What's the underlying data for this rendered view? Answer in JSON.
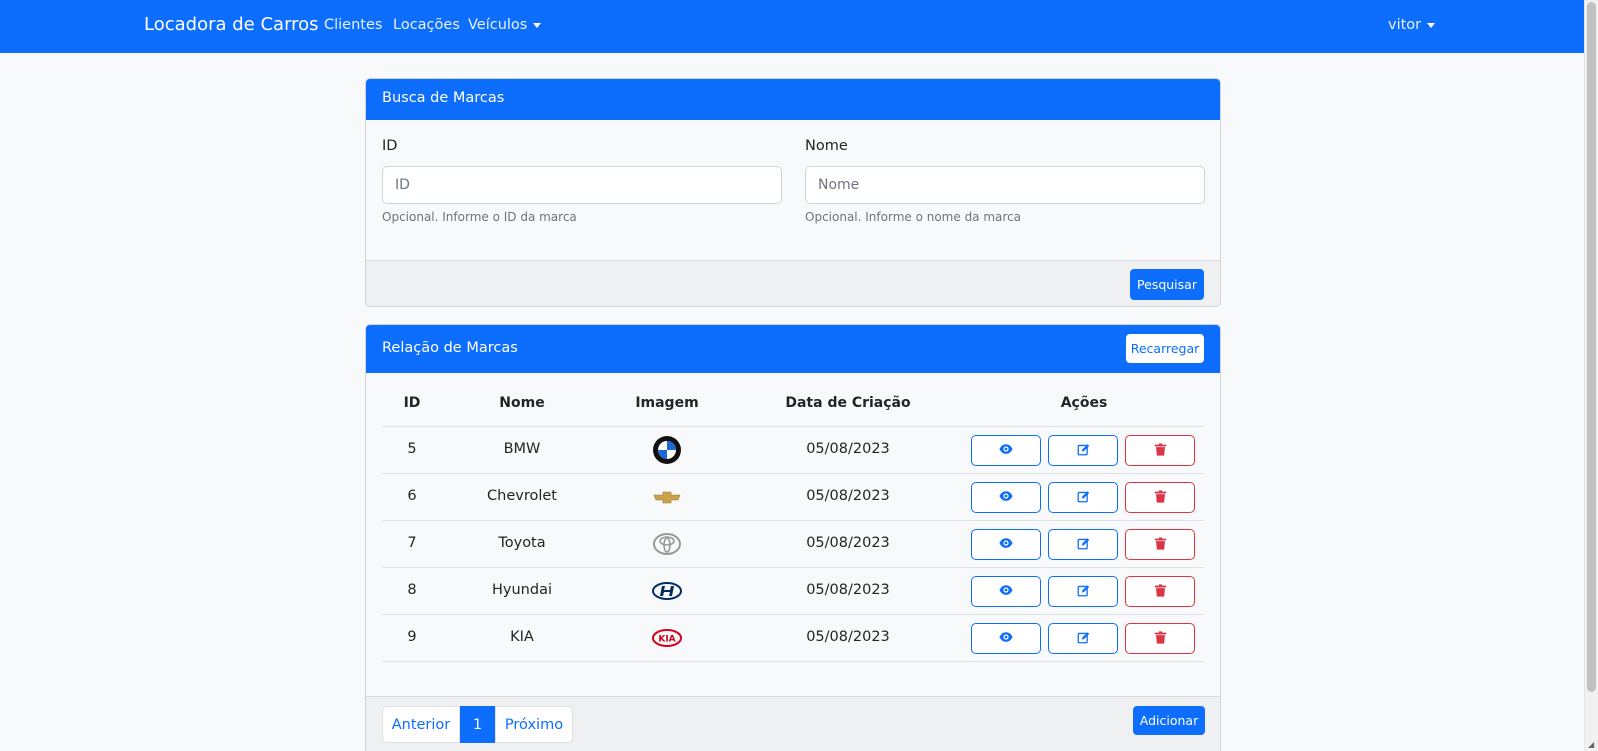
{
  "navbar": {
    "brand": "Locadora de Carros",
    "links": [
      "Clientes",
      "Locações",
      "Veículos"
    ],
    "user": "vitor",
    "color": "#0d6efd"
  },
  "search_card": {
    "title": "Busca de Marcas",
    "id_label": "ID",
    "id_placeholder": "ID",
    "id_help": "Opcional. Informe o ID da marca",
    "name_label": "Nome",
    "name_placeholder": "Nome",
    "name_help": "Opcional. Informe o nome da marca",
    "search_button": "Pesquisar"
  },
  "list_card": {
    "title": "Relação de Marcas",
    "reload_button": "Recarregar",
    "columns": [
      "ID",
      "Nome",
      "Imagem",
      "Data de Criação",
      "Ações"
    ],
    "rows": [
      {
        "id": "5",
        "name": "BMW",
        "logo": "bmw-logo",
        "date": "05/08/2023"
      },
      {
        "id": "6",
        "name": "Chevrolet",
        "logo": "chevrolet-logo",
        "date": "05/08/2023"
      },
      {
        "id": "7",
        "name": "Toyota",
        "logo": "toyota-logo",
        "date": "05/08/2023"
      },
      {
        "id": "8",
        "name": "Hyundai",
        "logo": "hyundai-logo",
        "date": "05/08/2023"
      },
      {
        "id": "9",
        "name": "KIA",
        "logo": "kia-logo",
        "date": "05/08/2023"
      }
    ],
    "row_actions": [
      "eye-icon",
      "edit-icon",
      "trash-icon"
    ],
    "pagination": {
      "prev": "Anterior",
      "current": "1",
      "next": "Próximo"
    },
    "add_button": "Adicionar"
  },
  "colors": {
    "primary": "#0d6efd",
    "danger": "#dc3545"
  }
}
